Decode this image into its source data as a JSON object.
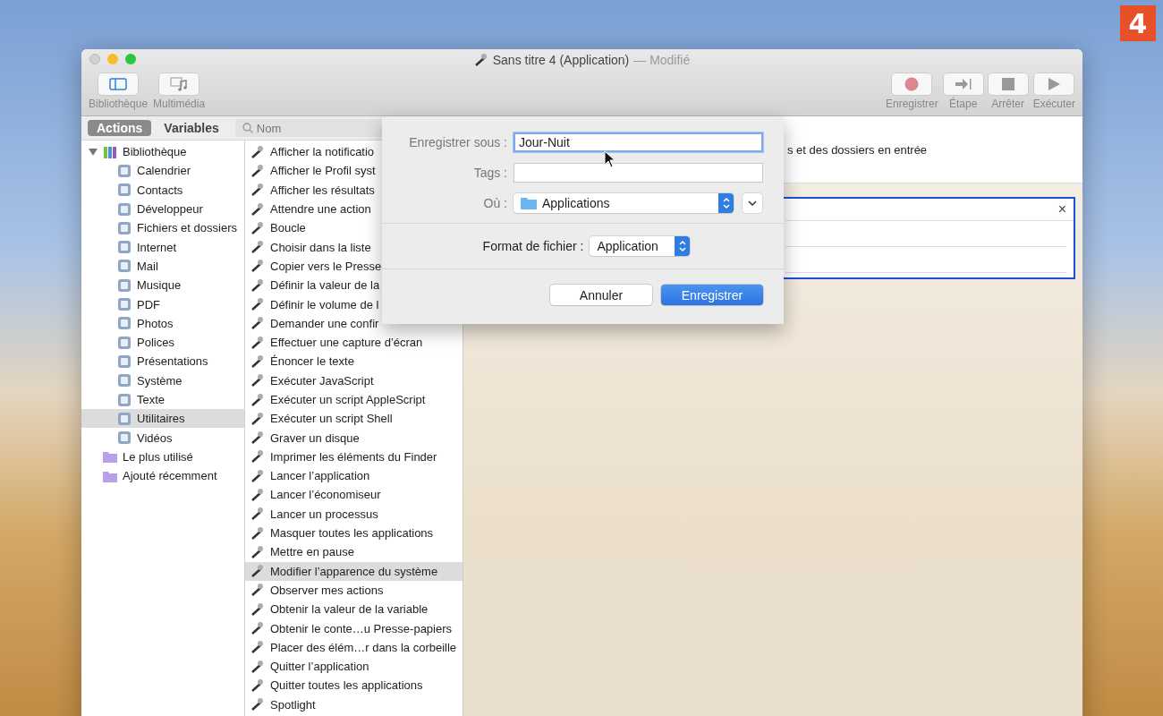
{
  "window": {
    "title": "Sans titre 4 (Application)",
    "title_suffix": "— Modifié"
  },
  "toolbar_left": [
    {
      "label": "Bibliothèque",
      "selected": true
    },
    {
      "label": "Multimédia",
      "selected": false
    }
  ],
  "toolbar_right": [
    {
      "label": "Enregistrer",
      "kind": "record"
    },
    {
      "label": "Étape",
      "kind": "step"
    },
    {
      "label": "Arrêter",
      "kind": "stop"
    },
    {
      "label": "Exécuter",
      "kind": "run"
    }
  ],
  "segments": [
    {
      "label": "Actions",
      "selected": true
    },
    {
      "label": "Variables",
      "selected": false
    }
  ],
  "search": {
    "placeholder": "Nom"
  },
  "library": [
    {
      "label": "Bibliothèque",
      "expanded": true,
      "selected": false,
      "children": [
        {
          "label": "Calendrier",
          "selected": false
        },
        {
          "label": "Contacts",
          "selected": false
        },
        {
          "label": "Développeur",
          "selected": false
        },
        {
          "label": "Fichiers et dossiers",
          "selected": false
        },
        {
          "label": "Internet",
          "selected": false
        },
        {
          "label": "Mail",
          "selected": false
        },
        {
          "label": "Musique",
          "selected": false
        },
        {
          "label": "PDF",
          "selected": false
        },
        {
          "label": "Photos",
          "selected": false
        },
        {
          "label": "Polices",
          "selected": false
        },
        {
          "label": "Présentations",
          "selected": false
        },
        {
          "label": "Système",
          "selected": false
        },
        {
          "label": "Texte",
          "selected": false
        },
        {
          "label": "Utilitaires",
          "selected": true
        },
        {
          "label": "Vidéos",
          "selected": false
        }
      ]
    },
    {
      "label": "Le plus utilisé",
      "selected": false
    },
    {
      "label": "Ajouté récemment",
      "selected": false
    }
  ],
  "actions": [
    {
      "label": "Afficher la notificatio",
      "selected": false
    },
    {
      "label": "Afficher le Profil syst",
      "selected": false
    },
    {
      "label": "Afficher les résultats",
      "selected": false
    },
    {
      "label": "Attendre une action",
      "selected": false
    },
    {
      "label": "Boucle",
      "selected": false
    },
    {
      "label": "Choisir dans la liste",
      "selected": false
    },
    {
      "label": "Copier vers le Presse",
      "selected": false
    },
    {
      "label": "Définir la valeur de la",
      "selected": false
    },
    {
      "label": "Définir le volume de l",
      "selected": false
    },
    {
      "label": "Demander une confir",
      "selected": false
    },
    {
      "label": "Effectuer une capture d’écran",
      "selected": false
    },
    {
      "label": "Énoncer le texte",
      "selected": false
    },
    {
      "label": "Exécuter JavaScript",
      "selected": false
    },
    {
      "label": "Exécuter un script AppleScript",
      "selected": false
    },
    {
      "label": "Exécuter un script Shell",
      "selected": false
    },
    {
      "label": "Graver un disque",
      "selected": false
    },
    {
      "label": "Imprimer les éléments du Finder",
      "selected": false
    },
    {
      "label": "Lancer l’application",
      "selected": false
    },
    {
      "label": "Lancer l’économiseur",
      "selected": false
    },
    {
      "label": "Lancer un processus",
      "selected": false
    },
    {
      "label": "Masquer toutes les applications",
      "selected": false
    },
    {
      "label": "Mettre en pause",
      "selected": false
    },
    {
      "label": "Modifier l’apparence du système",
      "selected": true
    },
    {
      "label": "Observer mes actions",
      "selected": false
    },
    {
      "label": "Obtenir la valeur de la variable",
      "selected": false
    },
    {
      "label": "Obtenir le conte…u Presse-papiers",
      "selected": false
    },
    {
      "label": "Placer des élém…r dans la corbeille",
      "selected": false
    },
    {
      "label": "Quitter l’application",
      "selected": false
    },
    {
      "label": "Quitter toutes les applications",
      "selected": false
    },
    {
      "label": "Spotlight",
      "selected": false
    }
  ],
  "workflow": {
    "header_text": "s et des dossiers en entrée",
    "card_close": "×"
  },
  "save_sheet": {
    "name_label": "Enregistrer sous :",
    "name_value": "Jour-Nuit",
    "tags_label": "Tags :",
    "where_label": "Où :",
    "where_value": "Applications",
    "format_label": "Format de fichier :",
    "format_value": "Application",
    "cancel": "Annuler",
    "save": "Enregistrer"
  },
  "step_badge": "4"
}
